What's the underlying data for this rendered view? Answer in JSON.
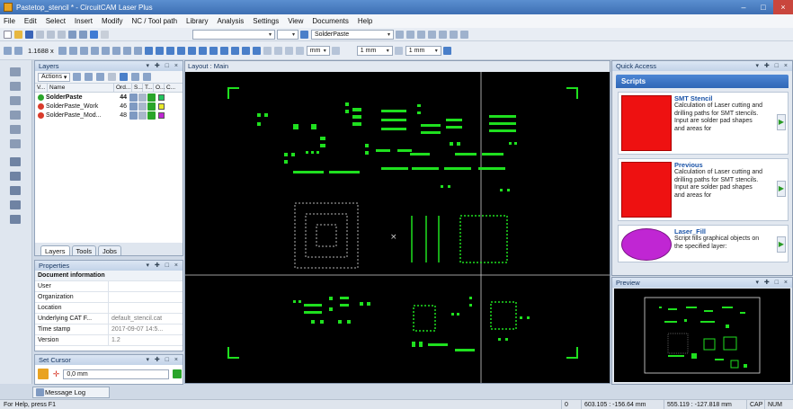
{
  "window": {
    "title": "Pastetop_stencil * - CircuitCAM Laser Plus",
    "controls": [
      "–",
      "□",
      "×"
    ]
  },
  "menu": [
    "File",
    "Edit",
    "Select",
    "Insert",
    "Modify",
    "NC / Tool path",
    "Library",
    "Analysis",
    "Settings",
    "View",
    "Documents",
    "Help"
  ],
  "toolbar": {
    "zoom_value": "1.1688 x",
    "layer_combo": "SolderPaste",
    "unit_combo": "mm",
    "width_combo_1": "1 mm",
    "width_combo_2": "1 mm"
  },
  "layers": {
    "title": "Layers",
    "pin": "▾ ✚ □ ×",
    "actions_label": "Actions",
    "columns": [
      "V...",
      "Name",
      "Ord...",
      "S...",
      "T...",
      "O...",
      "C..."
    ],
    "rows": [
      {
        "name": "SolderPaste",
        "order": "44",
        "color": "#22c55e",
        "selected": true,
        "icon_color": "#2aa52a"
      },
      {
        "name": "SolderPaste_Work",
        "order": "46",
        "color": "#e9e92a",
        "selected": false,
        "icon_color": "#d93b2b"
      },
      {
        "name": "SolderPaste_Mod...",
        "order": "48",
        "color": "#c026d3",
        "selected": false,
        "icon_color": "#d93b2b"
      }
    ],
    "tabs": [
      "Layers",
      "Tools",
      "Jobs"
    ]
  },
  "properties": {
    "title": "Properties",
    "pin": "▾ ✚ □ ×",
    "rows": [
      {
        "key": "Document information",
        "value": "",
        "bold": true
      },
      {
        "key": "User",
        "value": ""
      },
      {
        "key": "Organization",
        "value": ""
      },
      {
        "key": "Location",
        "value": ""
      },
      {
        "key": "Underlying CAT F...",
        "value": "default_stencil.cat"
      },
      {
        "key": "Time stamp",
        "value": "2017-09-07 14:5..."
      },
      {
        "key": "Version",
        "value": "1.2"
      }
    ]
  },
  "set_cursor": {
    "title": "Set Cursor",
    "pin": "▾ ✚ □ ×",
    "value": "0,0 mm"
  },
  "message_log": "Message Log",
  "layout": {
    "title": "Layout : Main"
  },
  "quick_access": {
    "title": "Quick Access",
    "pin": "▾ ✚ □ ×",
    "section": "Scripts",
    "items": [
      {
        "title": "SMT Stencil",
        "desc": "Calculation of Laser cutting and drilling paths for SMT stencils. Input are solder pad shapes and areas for",
        "thumb": "red-square"
      },
      {
        "title": "Previous",
        "desc": "Calculation of Laser cutting and drilling paths for SMT stencils. Input are solder pad shapes and areas for",
        "thumb": "red-square"
      },
      {
        "title": "Laser_Fill",
        "desc": "Script fills graphical objects on the specified layer:",
        "thumb": "magenta-circle"
      }
    ]
  },
  "preview": {
    "title": "Preview",
    "pin": "▾ ✚ □ ×"
  },
  "status": {
    "help": "For Help, press F1",
    "zero": "0",
    "coord1": "603.105 : -156.64 mm",
    "coord2": "555.119 : -127.818 mm",
    "cap": "CAP",
    "num": "NUM"
  },
  "colors": {
    "pad": "#1fe01f",
    "canvas": "#000000",
    "frame": "#c8d5e6",
    "accent": "#2f67b6"
  }
}
